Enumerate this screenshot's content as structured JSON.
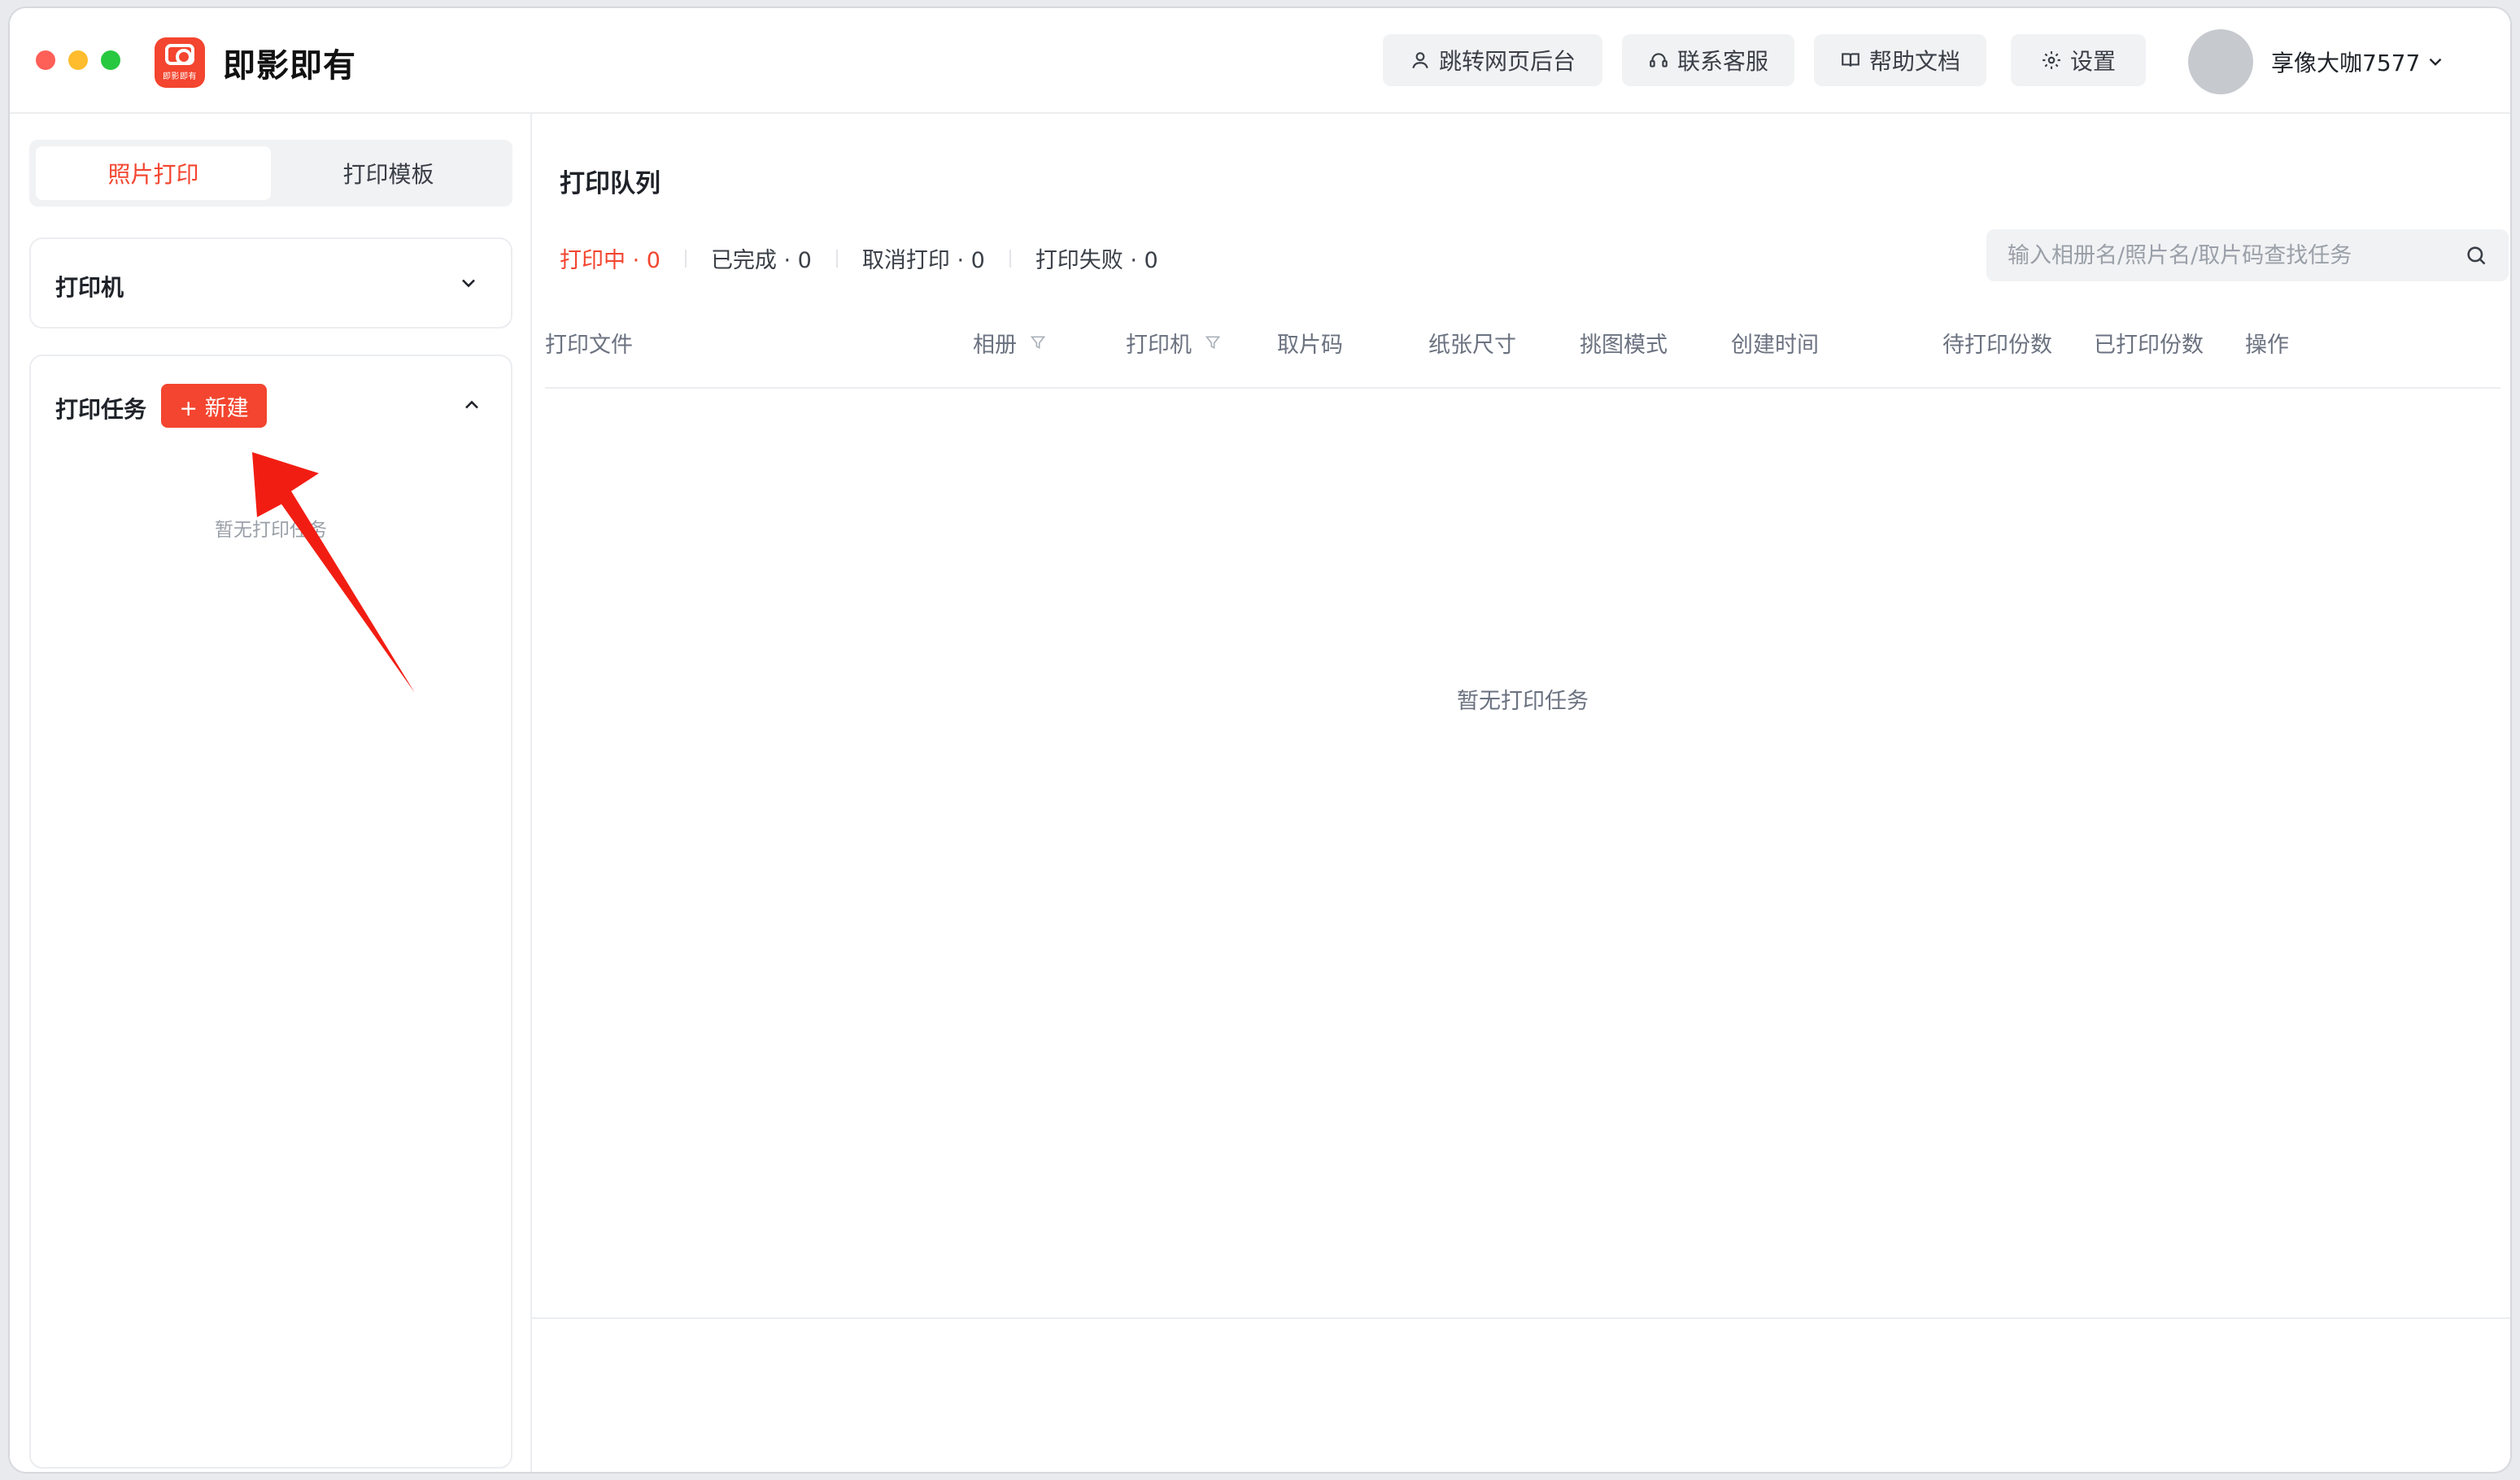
{
  "app": {
    "name": "即影即有",
    "logo_text": "即影即有"
  },
  "header": {
    "buttons": {
      "web_backend": "跳转网页后台",
      "support": "联系客服",
      "help": "帮助文档",
      "settings": "设置"
    },
    "user": {
      "name": "享像大咖7577"
    }
  },
  "sidebar": {
    "tabs": {
      "photo_print": "照片打印",
      "templates": "打印模板"
    },
    "printer": {
      "title": "打印机"
    },
    "tasks": {
      "title": "打印任务",
      "new_label": "+ 新建",
      "empty": "暂无打印任务"
    }
  },
  "main": {
    "title": "打印队列",
    "filters": {
      "printing": "打印中 · 0",
      "done": "已完成 · 0",
      "cancelled": "取消打印 · 0",
      "failed": "打印失败 · 0"
    },
    "search": {
      "placeholder": "输入相册名/照片名/取片码查找任务"
    },
    "columns": [
      "打印文件",
      "相册",
      "打印机",
      "取片码",
      "纸张尺寸",
      "挑图模式",
      "创建时间",
      "待打印份数",
      "已打印份数",
      "操作"
    ],
    "empty": "暂无打印任务"
  },
  "colors": {
    "accent": "#f3452f",
    "traffic_close": "#fe5f57",
    "traffic_min": "#febc2e",
    "traffic_max": "#28c840"
  },
  "icons": {
    "web_backend": "user-icon",
    "support": "headset-icon",
    "help": "book-icon",
    "settings": "gear-icon",
    "user_menu": "chevron-down-icon",
    "search": "search-icon",
    "filter": "filter-icon"
  }
}
